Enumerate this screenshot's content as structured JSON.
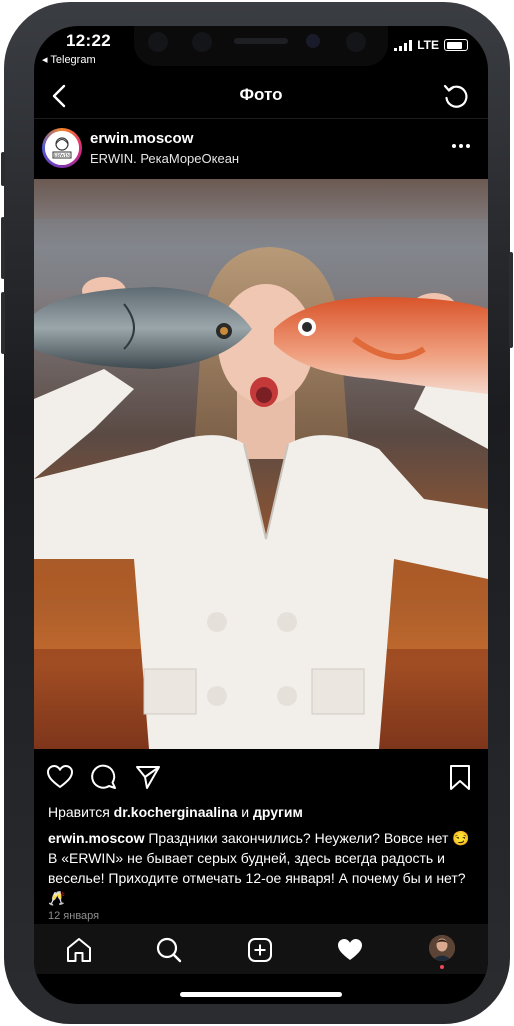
{
  "status_bar": {
    "time": "12:22",
    "back_app": "◂ Telegram",
    "network": "LTE"
  },
  "nav": {
    "title": "Фото"
  },
  "post": {
    "username": "erwin.moscow",
    "location": "ERWIN. РекаМореОкеан",
    "likes": {
      "prefix": "Нравится",
      "user": "dr.kocherginaalina",
      "middle": "и",
      "suffix": "другим"
    },
    "caption_user": "erwin.moscow",
    "caption_text": " Праздники закончились? Неужели? Вовсе нет 😏 В «ERWIN» не бывает серых будней, здесь всегда радость и веселье! Приходите отмечать 12-ое января! А почему бы и нет? 🥂",
    "date": "12 января"
  },
  "icons": {
    "back": "chevron-left-icon",
    "refresh": "refresh-icon",
    "more": "more-dots-icon",
    "like": "heart-outline-icon",
    "comment": "comment-icon",
    "share": "paper-plane-icon",
    "save": "bookmark-icon",
    "tabs": [
      "home-icon",
      "search-icon",
      "add-icon",
      "heart-filled-icon",
      "profile-avatar"
    ]
  },
  "colors": {
    "background": "#000000",
    "text": "#ffffff",
    "secondary_text": "#8e8e8e",
    "notification": "#ed4956"
  }
}
